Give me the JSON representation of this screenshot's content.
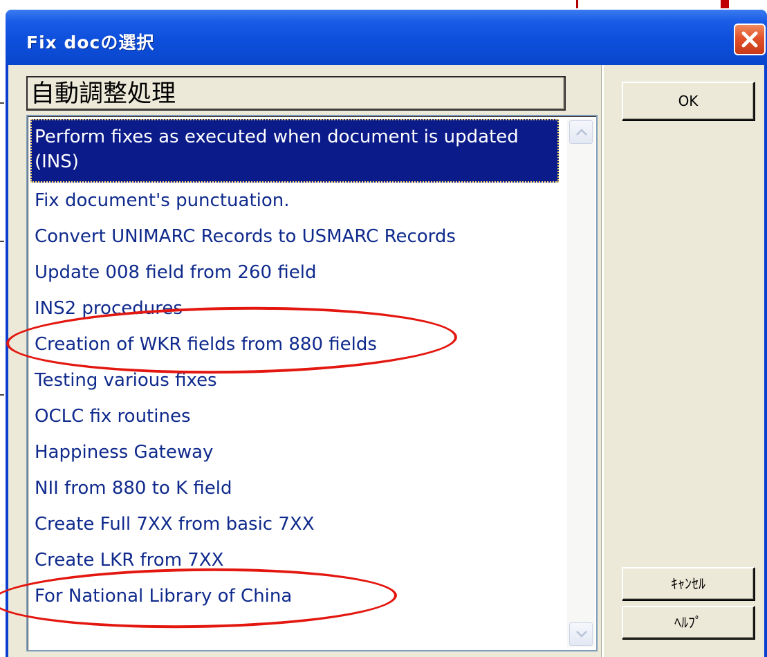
{
  "dialog": {
    "title": "Fix docの選択",
    "close_icon": "close-icon"
  },
  "combo": {
    "value": "自動調整処理"
  },
  "list": {
    "items": [
      "Perform fixes as executed when document is updated (INS)",
      "Fix document's punctuation.",
      "Convert UNIMARC Records to USMARC Records",
      "Update 008 field from 260 field",
      "INS2 procedures",
      "Creation of WKR fields from 880 fields",
      "Testing various fixes",
      "OCLC fix routines",
      "Happiness Gateway",
      "NII from 880 to K field",
      "Create Full 7XX from basic 7XX",
      "Create LKR from 7XX",
      "For National Library of China"
    ],
    "selected_index": 0
  },
  "buttons": {
    "ok": "OK",
    "cancel": "ｷｬﾝｾﾙ",
    "help": "ﾍﾙﾌﾟ"
  },
  "colors": {
    "title_bar": "#0d4fdc",
    "selection": "#0b1b8a",
    "item_text": "#0f2a8c",
    "annotation": "#e3170f",
    "dialog_face": "#ece9d8"
  },
  "icons": {
    "scroll_up": "chevron-up-icon",
    "scroll_down": "chevron-down-icon"
  }
}
